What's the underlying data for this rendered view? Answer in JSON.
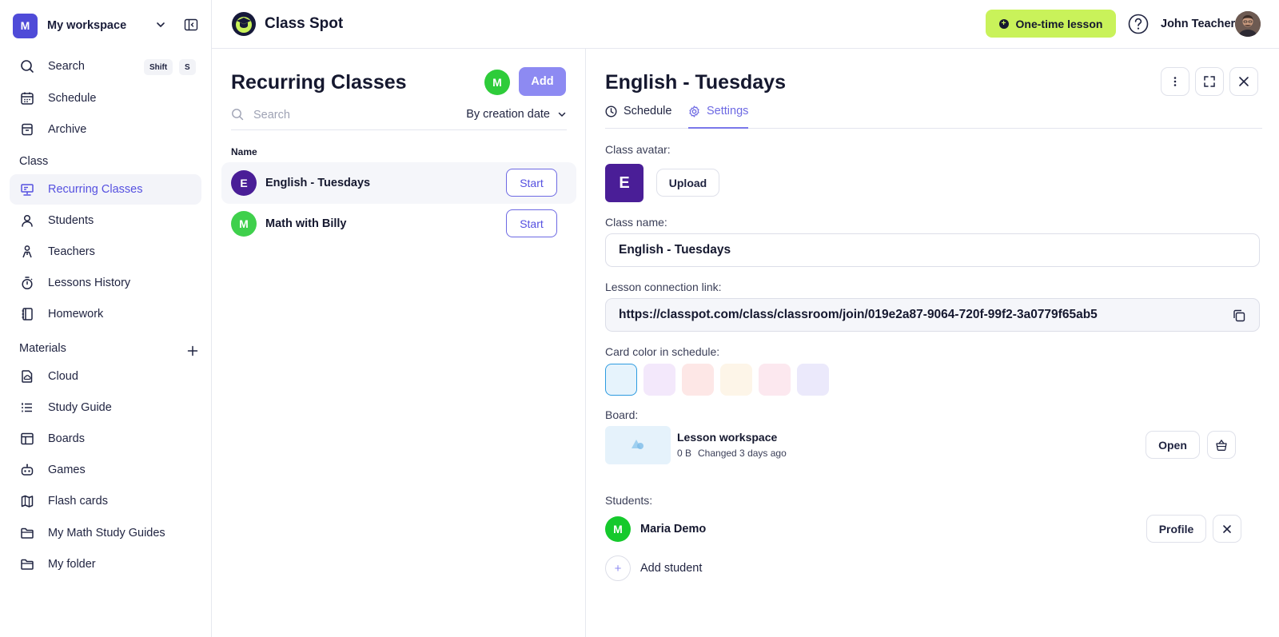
{
  "workspace": {
    "initial": "M",
    "name": "My workspace"
  },
  "sidebar": {
    "search": {
      "label": "Search",
      "shortcut": [
        "Shift",
        "S"
      ]
    },
    "items_top": [
      {
        "label": "Schedule",
        "icon": "calendar-icon"
      },
      {
        "label": "Archive",
        "icon": "archive-icon"
      }
    ],
    "class_section": "Class",
    "class_items": [
      {
        "label": "Recurring Classes",
        "icon": "presentation-icon",
        "active": true
      },
      {
        "label": "Students",
        "icon": "user-icon"
      },
      {
        "label": "Teachers",
        "icon": "teacher-icon"
      },
      {
        "label": "Lessons History",
        "icon": "stopwatch-icon"
      },
      {
        "label": "Homework",
        "icon": "notebook-icon"
      }
    ],
    "materials_section": "Materials",
    "material_items": [
      {
        "label": "Cloud",
        "icon": "cloud-file-icon"
      },
      {
        "label": "Study Guide",
        "icon": "list-icon"
      },
      {
        "label": "Boards",
        "icon": "board-icon"
      },
      {
        "label": "Games",
        "icon": "robot-icon"
      },
      {
        "label": "Flash cards",
        "icon": "map-icon"
      },
      {
        "label": "My Math Study Guides",
        "icon": "folder-icon"
      },
      {
        "label": "My folder",
        "icon": "folder-icon"
      }
    ]
  },
  "topbar": {
    "brand": "Class Spot",
    "one_time_label": "One-time lesson",
    "user_name": "John Teacher"
  },
  "list": {
    "title": "Recurring Classes",
    "badge": "M",
    "add_label": "Add",
    "search_placeholder": "Search",
    "sort_label": "By creation date",
    "column_name": "Name",
    "rows": [
      {
        "initial": "E",
        "name": "English - Tuesdays",
        "color": "#4a1e97",
        "start": "Start",
        "selected": true
      },
      {
        "initial": "M",
        "name": "Math with Billy",
        "color": "#3fd04c",
        "start": "Start",
        "selected": false
      }
    ]
  },
  "detail": {
    "title": "English - Tuesdays",
    "tabs": [
      {
        "label": "Schedule",
        "icon": "clock-icon"
      },
      {
        "label": "Settings",
        "icon": "gear-icon",
        "active": true
      }
    ],
    "avatar_label": "Class avatar:",
    "avatar_initial": "E",
    "upload_label": "Upload",
    "name_label": "Class name:",
    "name_value": "English - Tuesdays",
    "link_label": "Lesson connection link:",
    "link_value": "https://classpot.com/class/classroom/join/019e2a87-9064-720f-99f2-3a0779f65ab5",
    "color_label": "Card color in schedule:",
    "colors": [
      "#e6f3fc",
      "#f3e8fb",
      "#fde7e6",
      "#fdf5e8",
      "#fce8ef",
      "#ebe9fb"
    ],
    "board_label": "Board:",
    "board": {
      "name": "Lesson workspace",
      "size": "0 B",
      "changed": "Changed 3 days ago",
      "open_label": "Open"
    },
    "students_label": "Students:",
    "students": [
      {
        "initial": "M",
        "name": "Maria Demo",
        "profile_label": "Profile"
      }
    ],
    "add_student_label": "Add student"
  }
}
